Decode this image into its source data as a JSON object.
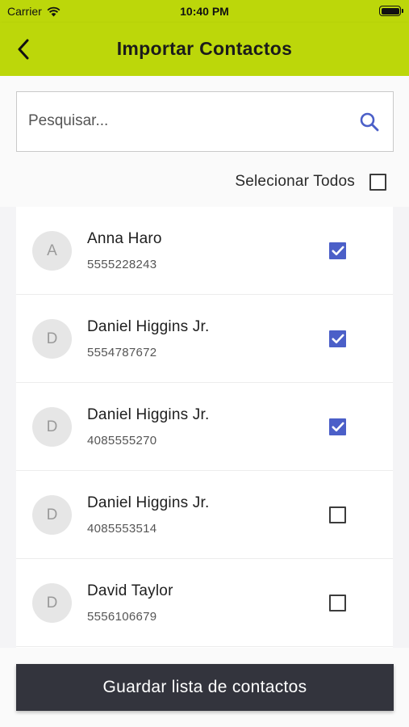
{
  "status_bar": {
    "carrier": "Carrier",
    "time": "10:40 PM"
  },
  "nav": {
    "title": "Importar Contactos",
    "back_icon": "chevron-left-icon"
  },
  "search": {
    "placeholder": "Pesquisar...",
    "value": "",
    "icon": "search-icon"
  },
  "select_all": {
    "label": "Selecionar Todos",
    "checked": false
  },
  "contacts": [
    {
      "initial": "A",
      "name": "Anna Haro",
      "phone": "5555228243",
      "checked": true
    },
    {
      "initial": "D",
      "name": "Daniel Higgins Jr.",
      "phone": "5554787672",
      "checked": true
    },
    {
      "initial": "D",
      "name": "Daniel Higgins Jr.",
      "phone": "4085555270",
      "checked": true
    },
    {
      "initial": "D",
      "name": "Daniel Higgins Jr.",
      "phone": "4085553514",
      "checked": false
    },
    {
      "initial": "D",
      "name": "David Taylor",
      "phone": "5556106679",
      "checked": false
    }
  ],
  "footer": {
    "save_label": "Guardar lista de contactos"
  },
  "colors": {
    "accent": "#bcd70a",
    "checkbox": "#4b5fc8",
    "button": "#33343d"
  }
}
